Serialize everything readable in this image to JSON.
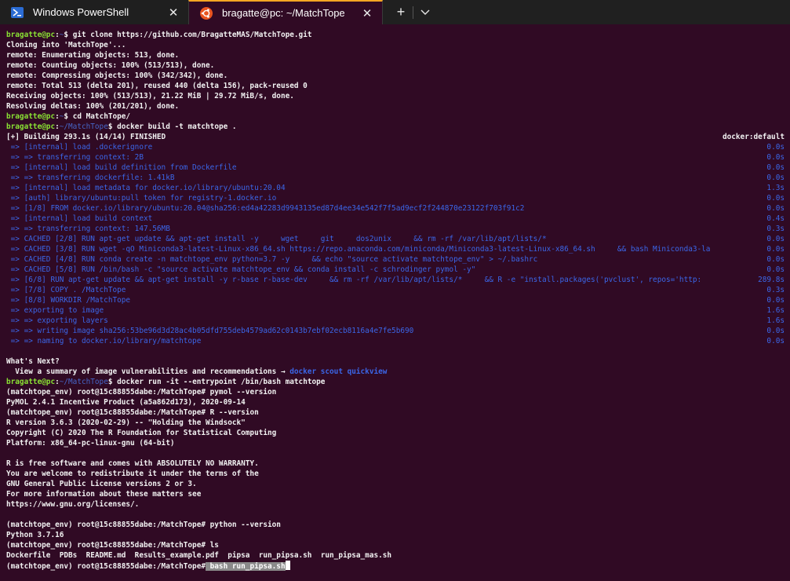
{
  "tabs": [
    {
      "label": "Windows PowerShell",
      "icon": "powershell-icon",
      "active": false
    },
    {
      "label": "bragatte@pc: ~/MatchTope",
      "icon": "ubuntu-icon",
      "active": true
    }
  ],
  "colors": {
    "background": "#300a24",
    "prompt_user": "#8ae234",
    "path": "#4666c8",
    "build_step": "#3b66e8",
    "tab_accent": "#f5a623"
  },
  "terminal": {
    "user": "bragatte@pc",
    "home": "~",
    "proj_path": "~/MatchTope",
    "cmd1": "git clone https://github.com/BragatteMAS/MatchTope.git",
    "clone_out": [
      "Cloning into 'MatchTope'...",
      "remote: Enumerating objects: 513, done.",
      "remote: Counting objects: 100% (513/513), done.",
      "remote: Compressing objects: 100% (342/342), done.",
      "remote: Total 513 (delta 201), reused 440 (delta 156), pack-reused 0",
      "Receiving objects: 100% (513/513), 21.22 MiB | 29.72 MiB/s, done.",
      "Resolving deltas: 100% (201/201), done."
    ],
    "cmd2": "cd MatchTope/",
    "cmd3": "docker build -t matchtope .",
    "build_header": "[+] Building 293.1s (14/14) FINISHED",
    "build_context": "docker:default",
    "build_steps": [
      {
        "text": " => [internal] load .dockerignore",
        "time": "0.0s"
      },
      {
        "text": " => => transferring context: 2B",
        "time": "0.0s"
      },
      {
        "text": " => [internal] load build definition from Dockerfile",
        "time": "0.0s"
      },
      {
        "text": " => => transferring dockerfile: 1.41kB",
        "time": "0.0s"
      },
      {
        "text": " => [internal] load metadata for docker.io/library/ubuntu:20.04",
        "time": "1.3s"
      },
      {
        "text": " => [auth] library/ubuntu:pull token for registry-1.docker.io",
        "time": "0.0s"
      },
      {
        "text": " => [1/8] FROM docker.io/library/ubuntu:20.04@sha256:ed4a42283d9943135ed87d4ee34e542f7f5ad9ecf2f244870e23122f703f91c2",
        "time": "0.0s"
      },
      {
        "text": " => [internal] load build context",
        "time": "0.4s"
      },
      {
        "text": " => => transferring context: 147.56MB",
        "time": "0.3s"
      },
      {
        "text": " => CACHED [2/8] RUN apt-get update && apt-get install -y     wget     git     dos2unix     && rm -rf /var/lib/apt/lists/*",
        "time": "0.0s"
      },
      {
        "text": " => CACHED [3/8] RUN wget -qO Miniconda3-latest-Linux-x86_64.sh https://repo.anaconda.com/miniconda/Miniconda3-latest-Linux-x86_64.sh     && bash Miniconda3-la",
        "time": "0.0s"
      },
      {
        "text": " => CACHED [4/8] RUN conda create -n matchtope_env python=3.7 -y     && echo \"source activate matchtope_env\" > ~/.bashrc",
        "time": "0.0s"
      },
      {
        "text": " => CACHED [5/8] RUN /bin/bash -c \"source activate matchtope_env && conda install -c schrodinger pymol -y\"",
        "time": "0.0s"
      },
      {
        "text": " => [6/8] RUN apt-get update && apt-get install -y r-base r-base-dev     && rm -rf /var/lib/apt/lists/*     && R -e \"install.packages('pvclust', repos='http:",
        "time": "289.8s"
      },
      {
        "text": " => [7/8] COPY . /MatchTope",
        "time": "0.3s"
      },
      {
        "text": " => [8/8] WORKDIR /MatchTope",
        "time": "0.0s"
      },
      {
        "text": " => exporting to image",
        "time": "1.6s"
      },
      {
        "text": " => => exporting layers",
        "time": "1.6s"
      },
      {
        "text": " => => writing image sha256:53be96d3d28ac4b05dfd755deb4579ad62c0143b7ebf02ecb8116a4e7fe5b690",
        "time": "0.0s"
      },
      {
        "text": " => => naming to docker.io/library/matchtope",
        "time": "0.0s"
      }
    ],
    "whats_next": "What's Next?",
    "scout_line": "  View a summary of image vulnerabilities and recommendations → ",
    "scout_cmd": "docker scout quickview",
    "cmd4": "docker run -it --entrypoint /bin/bash matchtope",
    "container_prompt": "(matchtope_env) root@15c88855dabe:/MatchTope#",
    "c_cmd1": "pymol --version",
    "pymol_out": "PyMOL 2.4.1 Incentive Product (a5a862d173), 2020-09-14",
    "c_cmd2": "R --version",
    "r_out": [
      "R version 3.6.3 (2020-02-29) -- \"Holding the Windsock\"",
      "Copyright (C) 2020 The R Foundation for Statistical Computing",
      "Platform: x86_64-pc-linux-gnu (64-bit)",
      "",
      "R is free software and comes with ABSOLUTELY NO WARRANTY.",
      "You are welcome to redistribute it under the terms of the",
      "GNU General Public License versions 2 or 3.",
      "For more information about these matters see",
      "https://www.gnu.org/licenses/.",
      ""
    ],
    "c_cmd3": "python --version",
    "python_out": "Python 3.7.16",
    "c_cmd4": "ls",
    "ls_out": "Dockerfile  PDBs  README.md  Results_example.pdf  pipsa  run_pipsa.sh  run_pipsa_mas.sh",
    "c_cmd5": " bash run_pipsa.sh"
  }
}
